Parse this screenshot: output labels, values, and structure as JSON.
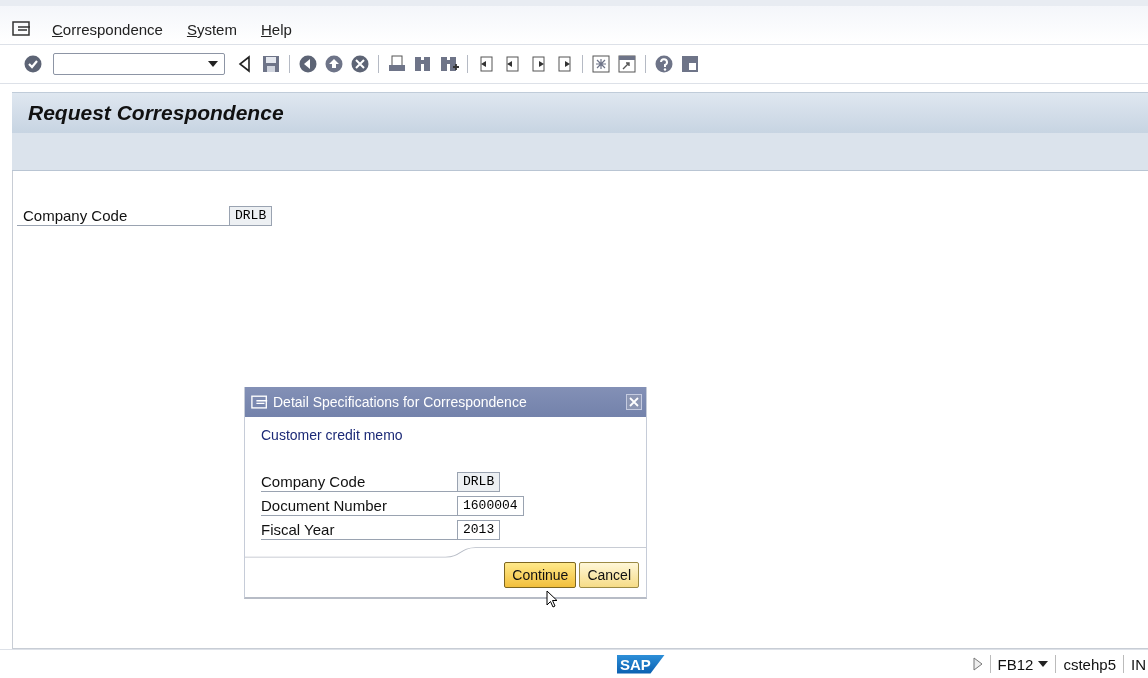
{
  "menu": [
    "Correspondence",
    "System",
    "Help"
  ],
  "title": "Request Correspondence",
  "main_fields": [
    {
      "label": "Company Code",
      "value": "DRLB",
      "editable": false
    }
  ],
  "dialog": {
    "title": "Detail Specifications for Correspondence",
    "subtitle": "Customer credit memo",
    "fields": [
      {
        "label": "Company Code",
        "value": "DRLB",
        "editable": false
      },
      {
        "label": "Document Number",
        "value": "1600004",
        "editable": true
      },
      {
        "label": "Fiscal Year",
        "value": "2013",
        "editable": true
      }
    ],
    "buttons": [
      {
        "label": "Continue",
        "selected": true
      },
      {
        "label": "Cancel",
        "selected": false
      }
    ]
  },
  "status_bar": {
    "logo": "SAP",
    "transaction": "FB12",
    "server": "cstehp5",
    "mode": "IN"
  }
}
